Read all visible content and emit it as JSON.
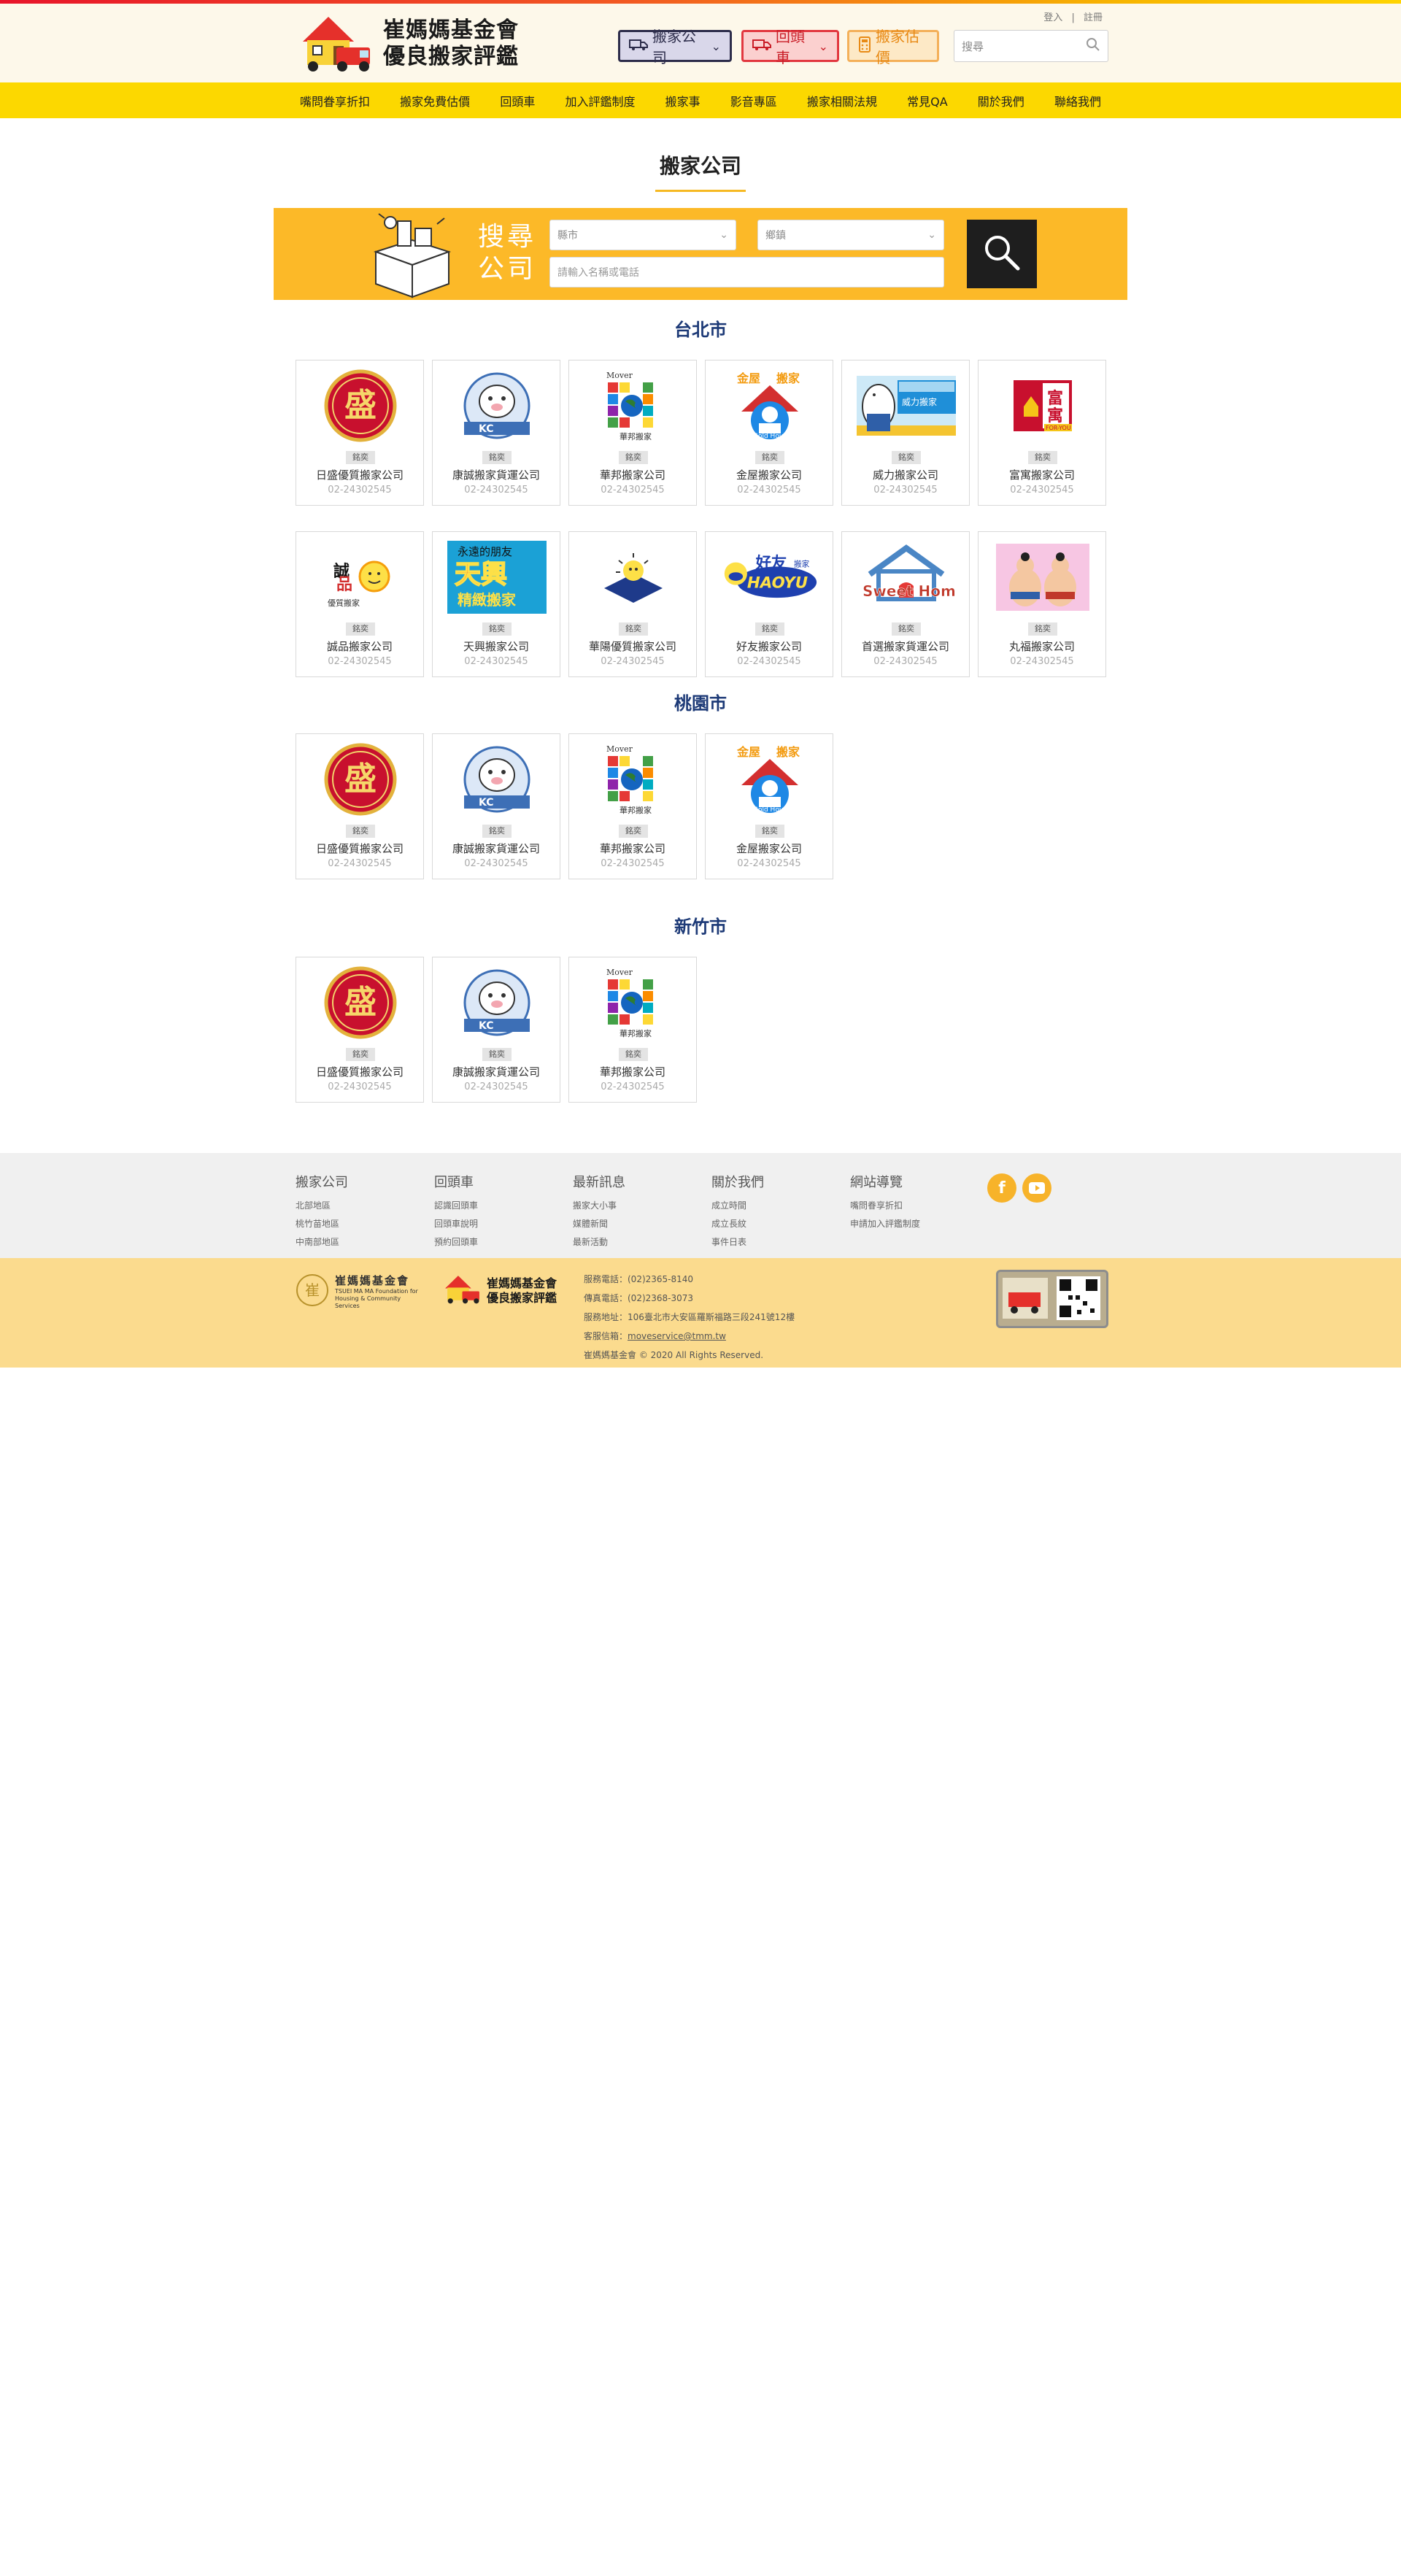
{
  "header": {
    "logo_line1": "崔媽媽基金會",
    "logo_line2": "優良搬家評鑑",
    "login": "登入",
    "separator": "|",
    "register": "註冊",
    "btn_mover": "搬家公司",
    "btn_back": "回頭車",
    "btn_estimate": "搬家估價",
    "search_placeholder": "搜尋"
  },
  "nav": [
    "嘴問眷享折扣",
    "搬家免費估價",
    "回頭車",
    "加入評鑑制度",
    "搬家事",
    "影音專區",
    "搬家相關法規",
    "常見QA",
    "關於我們",
    "聯絡我們"
  ],
  "page": {
    "title": "搬家公司",
    "search_label": "搜尋公司",
    "county_placeholder": "縣市",
    "district_placeholder": "鄉鎮",
    "keyword_placeholder": "請輸入名稱或電話"
  },
  "sections": [
    {
      "city": "台北市",
      "companies": [
        {
          "name": "日盛優質搬家公司",
          "tag": "銘奕",
          "phone": "02-24302545",
          "logo": "sheng"
        },
        {
          "name": "康誠搬家貨運公司",
          "tag": "銘奕",
          "phone": "02-24302545",
          "logo": "kc"
        },
        {
          "name": "華邦搬家公司",
          "tag": "銘奕",
          "phone": "02-24302545",
          "logo": "mover"
        },
        {
          "name": "金屋搬家公司",
          "tag": "銘奕",
          "phone": "02-24302545",
          "logo": "goldhouse"
        },
        {
          "name": "威力搬家公司",
          "tag": "銘奕",
          "phone": "02-24302545",
          "logo": "weili"
        },
        {
          "name": "富寓搬家公司",
          "tag": "銘奕",
          "phone": "02-24302545",
          "logo": "foryou"
        },
        {
          "name": "誠品搬家公司",
          "tag": "銘奕",
          "phone": "02-24302545",
          "logo": "chengpin"
        },
        {
          "name": "天興搬家公司",
          "tag": "銘奕",
          "phone": "02-24302545",
          "logo": "tianxing"
        },
        {
          "name": "華陽優質搬家公司",
          "tag": "銘奕",
          "phone": "02-24302545",
          "logo": "huayang"
        },
        {
          "name": "好友搬家公司",
          "tag": "銘奕",
          "phone": "02-24302545",
          "logo": "haoyu"
        },
        {
          "name": "首選搬家貨運公司",
          "tag": "銘奕",
          "phone": "02-24302545",
          "logo": "sweethome"
        },
        {
          "name": "丸福搬家公司",
          "tag": "銘奕",
          "phone": "02-24302545",
          "logo": "sumo"
        }
      ]
    },
    {
      "city": "桃園市",
      "companies": [
        {
          "name": "日盛優質搬家公司",
          "tag": "銘奕",
          "phone": "02-24302545",
          "logo": "sheng"
        },
        {
          "name": "康誠搬家貨運公司",
          "tag": "銘奕",
          "phone": "02-24302545",
          "logo": "kc"
        },
        {
          "name": "華邦搬家公司",
          "tag": "銘奕",
          "phone": "02-24302545",
          "logo": "mover"
        },
        {
          "name": "金屋搬家公司",
          "tag": "銘奕",
          "phone": "02-24302545",
          "logo": "goldhouse"
        }
      ]
    },
    {
      "city": "新竹市",
      "companies": [
        {
          "name": "日盛優質搬家公司",
          "tag": "銘奕",
          "phone": "02-24302545",
          "logo": "sheng"
        },
        {
          "name": "康誠搬家貨運公司",
          "tag": "銘奕",
          "phone": "02-24302545",
          "logo": "kc"
        },
        {
          "name": "華邦搬家公司",
          "tag": "銘奕",
          "phone": "02-24302545",
          "logo": "mover"
        }
      ]
    }
  ],
  "footer": {
    "columns": [
      {
        "heading": "搬家公司",
        "links": [
          "北部地區",
          "桃竹苗地區",
          "中南部地區"
        ]
      },
      {
        "heading": "回頭車",
        "links": [
          "認識回頭車",
          "回頭車說明",
          "預約回頭車"
        ]
      },
      {
        "heading": "最新訊息",
        "links": [
          "搬家大小事",
          "媒體新聞",
          "最新活動"
        ]
      },
      {
        "heading": "關於我們",
        "links": [
          "成立時間",
          "成立長紋",
          "事件日表"
        ]
      },
      {
        "heading": "網站導覽",
        "links": [
          "嘴問眷享折扣",
          "申請加入評鑑制度"
        ]
      }
    ],
    "social": [
      "facebook-icon",
      "youtube-icon"
    ],
    "foundation_name": "崔媽媽基金會",
    "foundation_en": "TSUEI MA MA Foundation for Housing & Community Services",
    "logo2_line1": "崔媽媽基金會",
    "logo2_line2": "優良搬家評鑑",
    "service_phone": "服務電話：(02)2365-8140",
    "fax": "傳真電話：(02)2368-3073",
    "address": "服務地址：106臺北市大安區羅斯福路三段241號12樓",
    "email_label": "客服信箱：",
    "email": "moveservice@tmm.tw",
    "copyright": "崔媽媽基金會 © 2020 All Rights Reserved."
  },
  "colors": {
    "nav_yellow": "#fcd800",
    "search_orange": "#fcb928",
    "city_blue": "#1d3a77",
    "footer_cream": "#fbdb8e"
  }
}
